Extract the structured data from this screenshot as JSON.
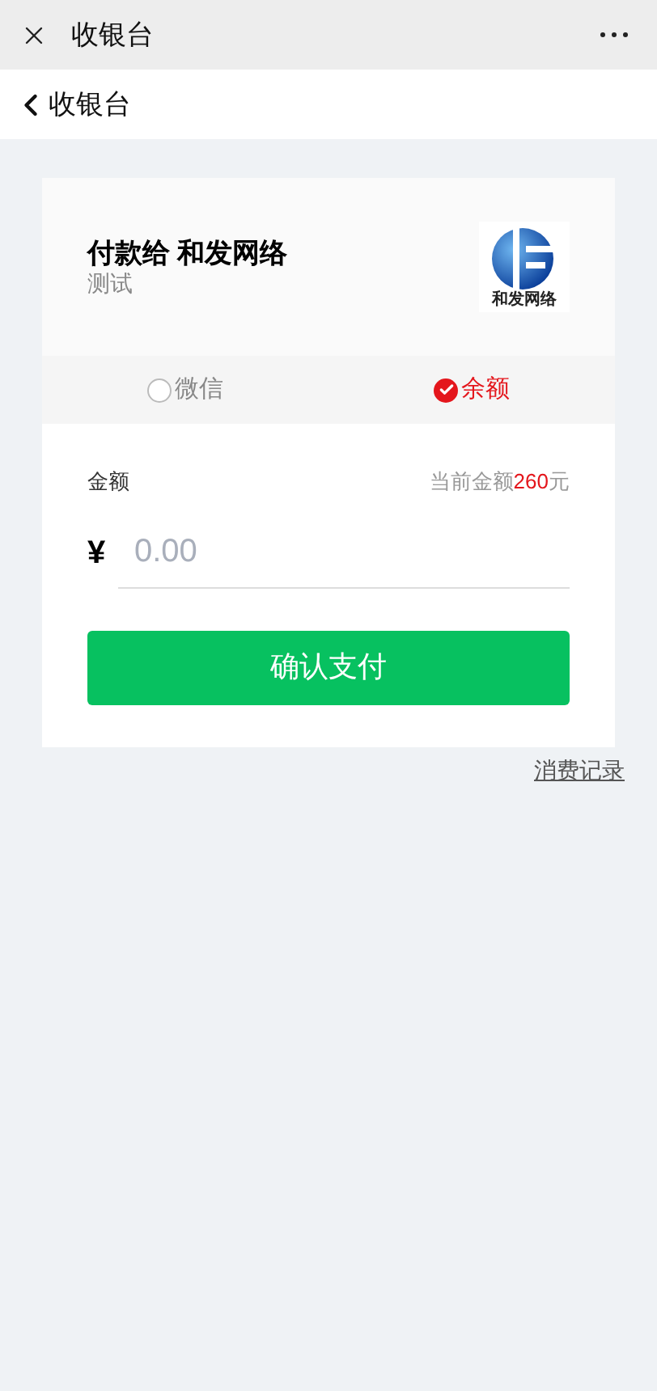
{
  "title_bar": {
    "title": "收银台"
  },
  "nav_bar": {
    "title": "收银台"
  },
  "merchant": {
    "heading": "付款给 和发网络",
    "subtitle": "测试",
    "logo_caption": "和发网络"
  },
  "payment_methods": [
    {
      "label": "微信",
      "selected": false
    },
    {
      "label": "余额",
      "selected": true
    }
  ],
  "amount": {
    "label": "金额",
    "balance_prefix": "当前金额",
    "balance_value": "260",
    "balance_suffix": "元",
    "currency": "¥",
    "placeholder": "0.00"
  },
  "confirm_button": "确认支付",
  "history_link": "消费记录"
}
